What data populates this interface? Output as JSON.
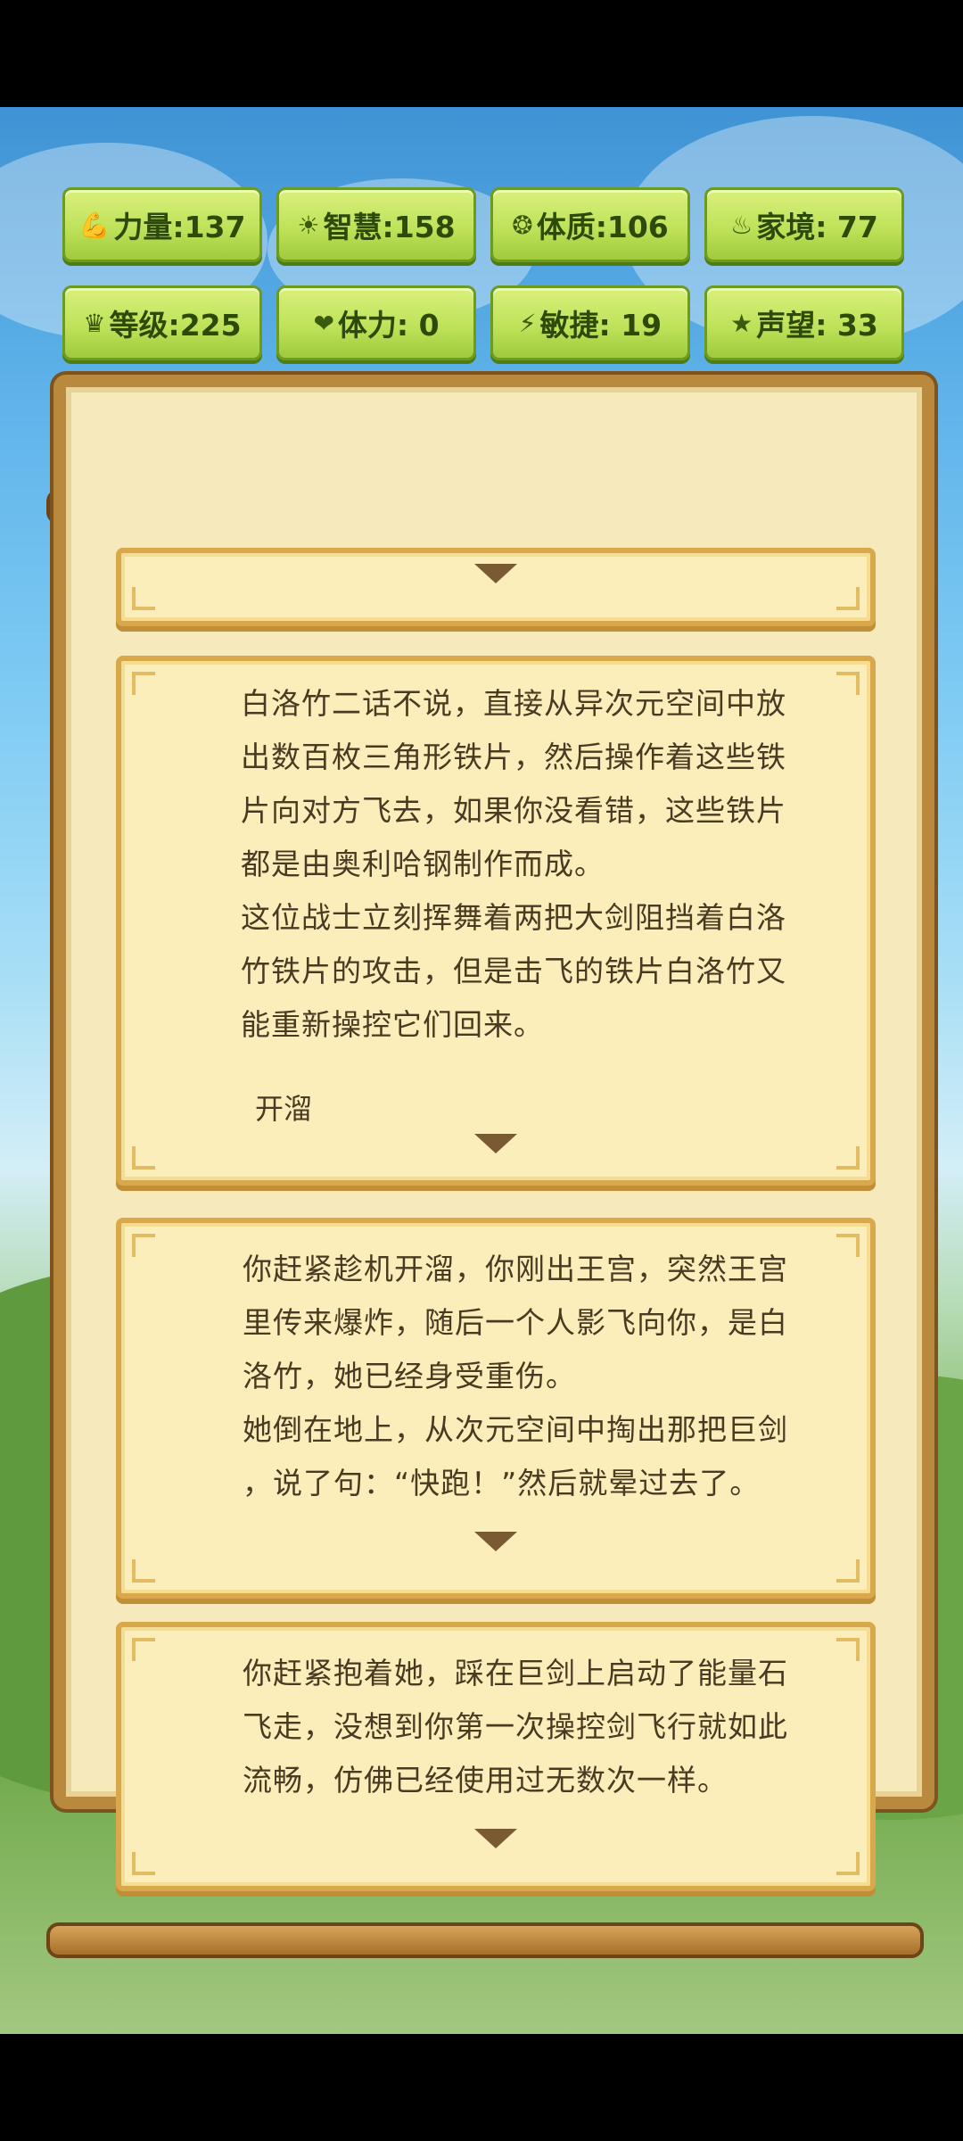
{
  "stats": [
    {
      "icon": "strength-icon",
      "glyph": "💪",
      "label": "力量:137"
    },
    {
      "icon": "wisdom-icon",
      "glyph": "☀",
      "label": "智慧:158"
    },
    {
      "icon": "constitution-icon",
      "glyph": "❂",
      "label": "体质:106"
    },
    {
      "icon": "family-icon",
      "glyph": "♨",
      "label": "家境: 77"
    },
    {
      "icon": "level-icon",
      "glyph": "♛",
      "label": "等级:225"
    },
    {
      "icon": "stamina-icon",
      "glyph": "❤",
      "label": "体力: 0"
    },
    {
      "icon": "agility-icon",
      "glyph": "⚡",
      "label": "敏捷: 19"
    },
    {
      "icon": "reputation-icon",
      "glyph": "★",
      "label": "声望: 33"
    }
  ],
  "story": {
    "card1": {
      "lines": [
        "白洛竹二话不说，直接从异次元空间中放",
        "出数百枚三角形铁片，然后操作着这些铁",
        "片向对方飞去，如果你没看错，这些铁片",
        "都是由奥利哈钢制作而成。",
        "这位战士立刻挥舞着两把大剑阻挡着白洛",
        "竹铁片的攻击，但是击飞的铁片白洛竹又",
        "能重新操控它们回来。"
      ],
      "choice": "开溜"
    },
    "card2": {
      "lines": [
        "你赶紧趁机开溜，你刚出王宫，突然王宫",
        "里传来爆炸，随后一个人影飞向你，是白",
        "洛竹，她已经身受重伤。",
        "她倒在地上，从次元空间中掏出那把巨剑",
        "，说了句：“快跑！”然后就晕过去了。"
      ]
    },
    "card3": {
      "lines": [
        "你赶紧抱着她，踩在巨剑上启动了能量石",
        "飞走，没想到你第一次操控剑飞行就如此",
        "流畅，仿佛已经使用过无数次一样。"
      ]
    }
  }
}
